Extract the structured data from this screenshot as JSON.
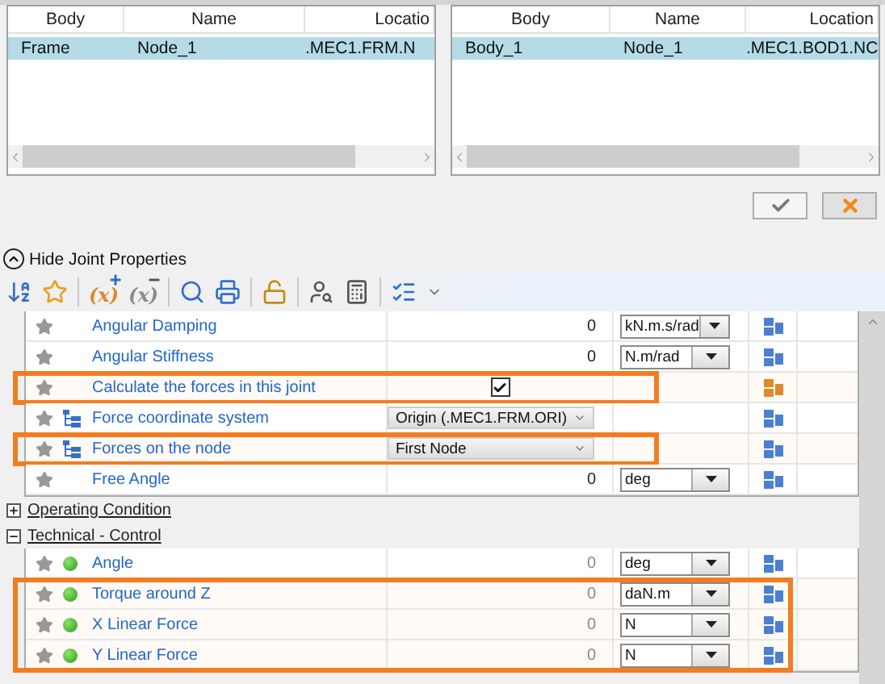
{
  "tables": [
    {
      "columns": [
        "Body",
        "Name",
        "Locatio"
      ],
      "rows": [
        {
          "cells": [
            "Frame",
            "Node_1",
            ".MEC1.FRM.N"
          ],
          "selected": true
        }
      ]
    },
    {
      "columns": [
        "Body",
        "Name",
        "Location"
      ],
      "rows": [
        {
          "cells": [
            "Body_1",
            "Node_1",
            ".MEC1.BOD1.NC"
          ],
          "selected": true
        }
      ]
    }
  ],
  "dialog_buttons": [
    {
      "kind": "ok"
    },
    {
      "kind": "cancel"
    }
  ],
  "properties_toggle": {
    "label": "Hide Joint Properties",
    "expanded": true
  },
  "toolbar": [
    {
      "kind": "sort"
    },
    {
      "kind": "favorite"
    },
    {
      "kind": "separator"
    },
    {
      "kind": "add_parameter",
      "label": "(x)"
    },
    {
      "kind": "remove_parameter",
      "label": "(x)"
    },
    {
      "kind": "separator"
    },
    {
      "kind": "search"
    },
    {
      "kind": "print"
    },
    {
      "kind": "separator"
    },
    {
      "kind": "lock"
    },
    {
      "kind": "separator"
    },
    {
      "kind": "inspect"
    },
    {
      "kind": "calculator"
    },
    {
      "kind": "separator"
    },
    {
      "kind": "checklist"
    },
    {
      "kind": "more"
    }
  ],
  "sections": [
    {
      "rows": [
        {
          "name": "Angular Damping",
          "kind": "number",
          "value": "0",
          "unit": "kN.m.s/rad",
          "color": "#4a7fd4",
          "highlighted": false
        },
        {
          "name": "Angular Stiffness",
          "kind": "number",
          "value": "0",
          "unit": "N.m/rad",
          "color": "#4a7fd4",
          "highlighted": false
        },
        {
          "name": "Calculate the forces in this joint",
          "kind": "checkbox",
          "checked": true,
          "color": "#e0892a",
          "highlighted": true
        },
        {
          "name": "Force coordinate system",
          "kind": "reference_select",
          "value": "Origin (.MEC1.FRM.ORI)",
          "color": "#4a7fd4",
          "highlighted": false
        },
        {
          "name": "Forces on the node",
          "kind": "reference_select",
          "value": "First Node",
          "color": "#4a7fd4",
          "highlighted": true
        },
        {
          "name": "Free Angle",
          "kind": "number",
          "value": "0",
          "unit": "deg",
          "color": "#4a7fd4",
          "highlighted": false
        }
      ]
    },
    {
      "title": "Operating Condition",
      "expanded": false
    },
    {
      "title": "Technical - Control",
      "expanded": true,
      "rows": [
        {
          "name": "Angle",
          "kind": "monitored_number",
          "value": "0",
          "unit": "deg",
          "color": "#4a7fd4",
          "highlighted": false
        },
        {
          "name": "Torque around Z",
          "kind": "monitored_number",
          "value": "0",
          "unit": "daN.m",
          "color": "#4a7fd4",
          "highlighted": true
        },
        {
          "name": "X Linear Force",
          "kind": "monitored_number",
          "value": "0",
          "unit": "N",
          "color": "#4a7fd4",
          "highlighted": true
        },
        {
          "name": "Y Linear Force",
          "kind": "monitored_number",
          "value": "0",
          "unit": "N",
          "color": "#4a7fd4",
          "highlighted": true
        }
      ]
    }
  ]
}
